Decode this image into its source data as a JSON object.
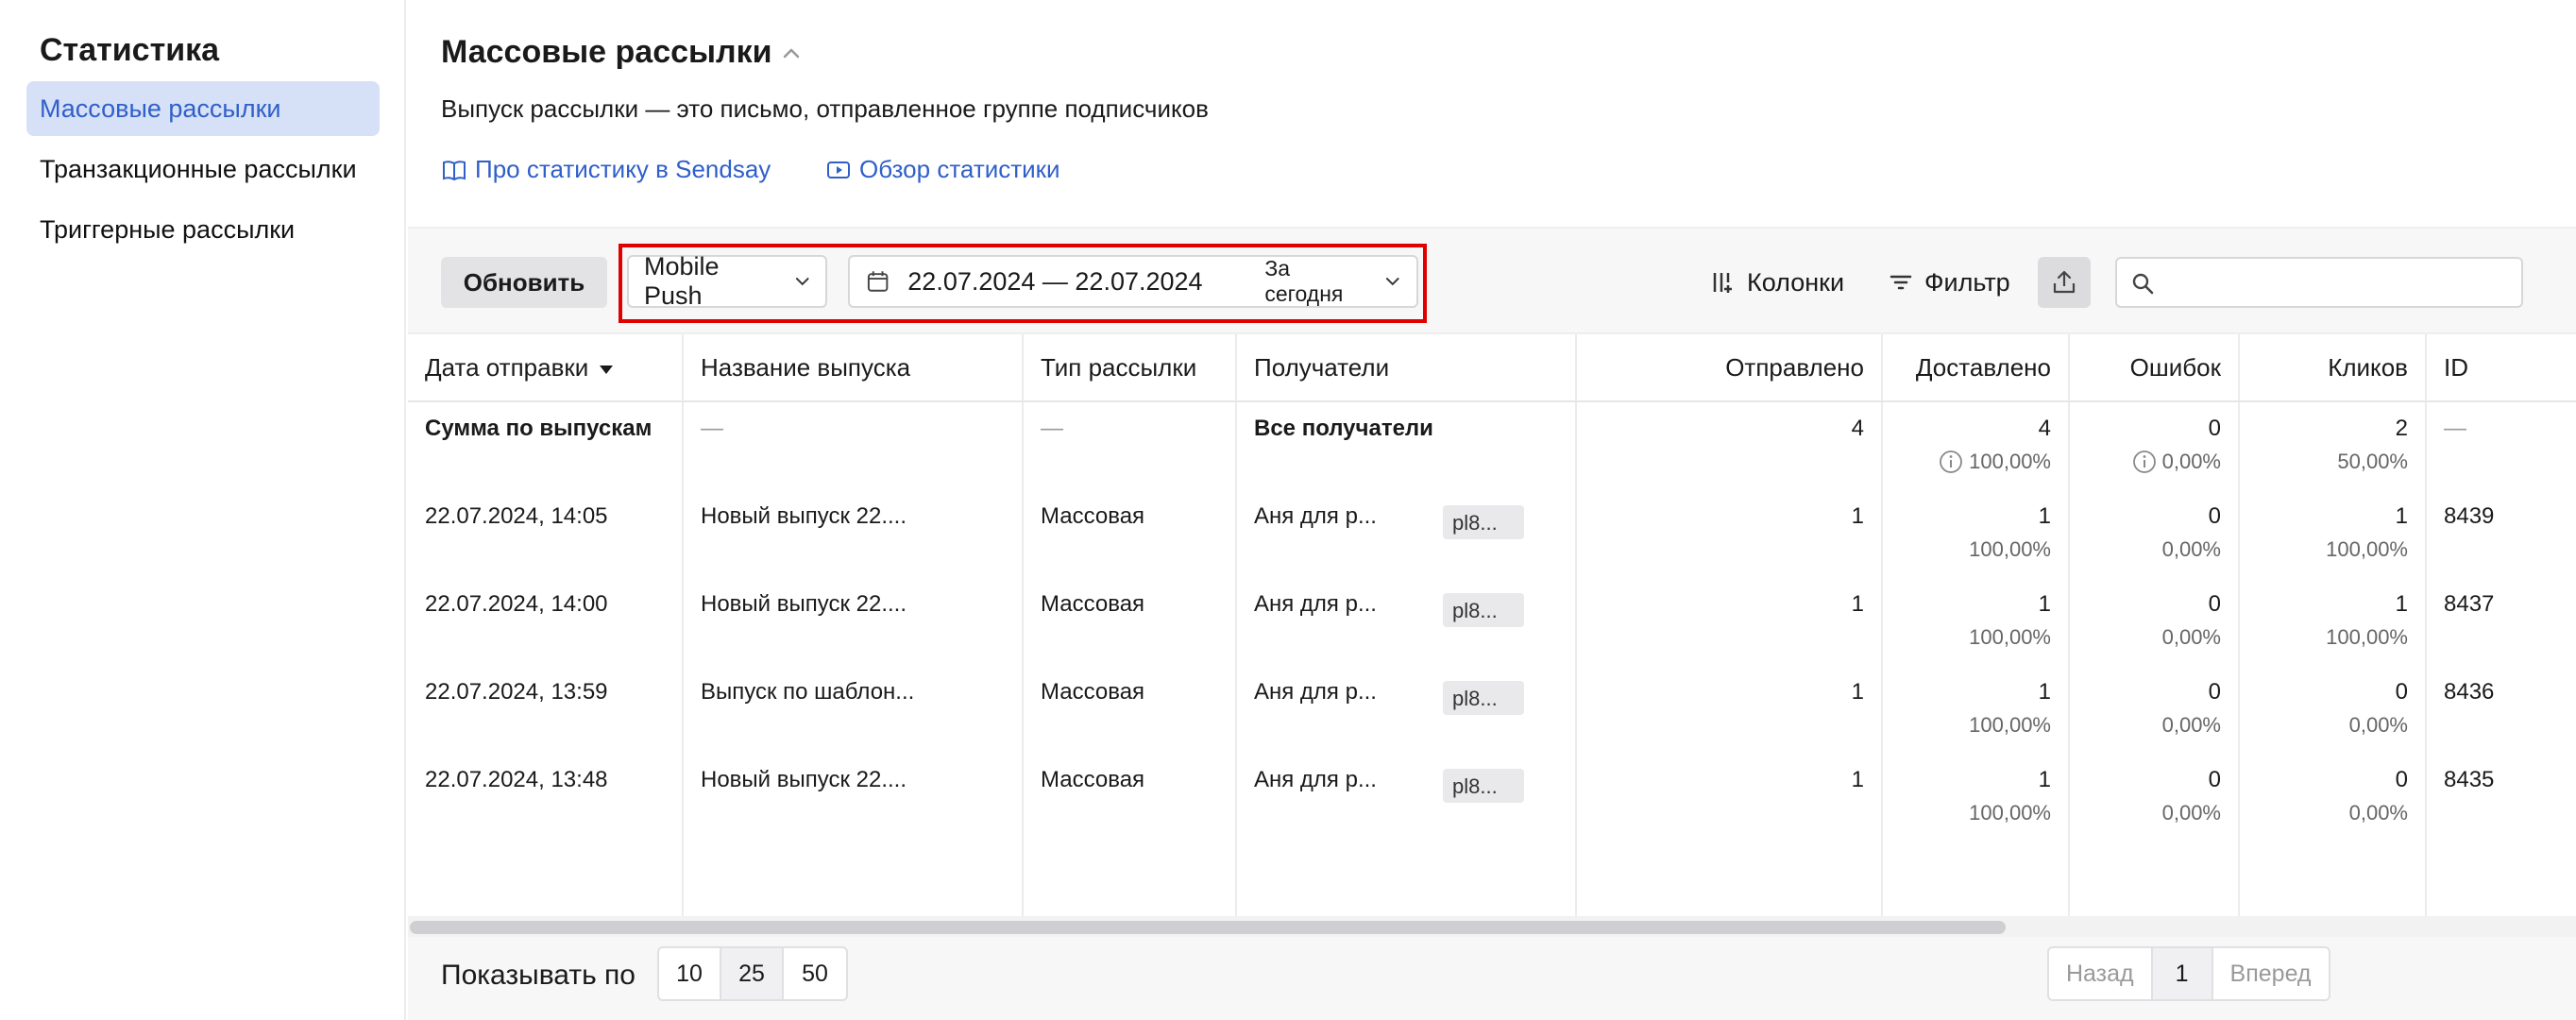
{
  "sidebar": {
    "title": "Статистика",
    "items": [
      {
        "label": "Массовые рассылки",
        "active": true
      },
      {
        "label": "Транзакционные рассылки",
        "active": false
      },
      {
        "label": "Триггерные рассылки",
        "active": false
      }
    ]
  },
  "header": {
    "title": "Массовые рассылки",
    "subtitle": "Выпуск рассылки — это письмо, отправленное группе подписчиков",
    "links": [
      {
        "label": "Про статистику в Sendsay",
        "icon": "book-icon"
      },
      {
        "label": "Обзор статистики",
        "icon": "video-icon"
      }
    ]
  },
  "toolbar": {
    "refresh_label": "Обновить",
    "channel_value": "Mobile Push",
    "date_range": "22.07.2024 — 22.07.2024",
    "period_value": "За сегодня",
    "columns_label": "Колонки",
    "filter_label": "Фильтр",
    "search_placeholder": ""
  },
  "table": {
    "columns": [
      "Дата отправки",
      "Название выпуска",
      "Тип рассылки",
      "Получатели",
      "Отправлено",
      "Доставлено",
      "Ошибок",
      "Кликов",
      "ID"
    ],
    "summary": {
      "date": "Сумма по выпускам",
      "name": "—",
      "type": "—",
      "recipients": "Все получатели",
      "sent": "4",
      "delivered": "4",
      "delivered_pct": "100,00%",
      "errors": "0",
      "errors_pct": "0,00%",
      "clicks": "2",
      "clicks_pct": "50,00%",
      "id": "—"
    },
    "rows": [
      {
        "date": "22.07.2024, 14:05",
        "name": "Новый выпуск 22....",
        "type": "Массовая",
        "recipients": "Аня для р...",
        "tag": "pl8...",
        "sent": "1",
        "delivered": "1",
        "delivered_pct": "100,00%",
        "errors": "0",
        "errors_pct": "0,00%",
        "clicks": "1",
        "clicks_pct": "100,00%",
        "id": "8439"
      },
      {
        "date": "22.07.2024, 14:00",
        "name": "Новый выпуск 22....",
        "type": "Массовая",
        "recipients": "Аня для р...",
        "tag": "pl8...",
        "sent": "1",
        "delivered": "1",
        "delivered_pct": "100,00%",
        "errors": "0",
        "errors_pct": "0,00%",
        "clicks": "1",
        "clicks_pct": "100,00%",
        "id": "8437"
      },
      {
        "date": "22.07.2024, 13:59",
        "name": "Выпуск по шаблон...",
        "type": "Массовая",
        "recipients": "Аня для р...",
        "tag": "pl8...",
        "sent": "1",
        "delivered": "1",
        "delivered_pct": "100,00%",
        "errors": "0",
        "errors_pct": "0,00%",
        "clicks": "0",
        "clicks_pct": "0,00%",
        "id": "8436"
      },
      {
        "date": "22.07.2024, 13:48",
        "name": "Новый выпуск 22....",
        "type": "Массовая",
        "recipients": "Аня для р...",
        "tag": "pl8...",
        "sent": "1",
        "delivered": "1",
        "delivered_pct": "100,00%",
        "errors": "0",
        "errors_pct": "0,00%",
        "clicks": "0",
        "clicks_pct": "0,00%",
        "id": "8435"
      }
    ]
  },
  "footer": {
    "show_label": "Показывать по",
    "page_sizes": [
      "10",
      "25",
      "50"
    ],
    "prev_label": "Назад",
    "current_page": "1",
    "next_label": "Вперед"
  },
  "colors": {
    "accent": "#2f5fc9",
    "active_bg": "#d6e0f6",
    "highlight": "#e00000"
  }
}
